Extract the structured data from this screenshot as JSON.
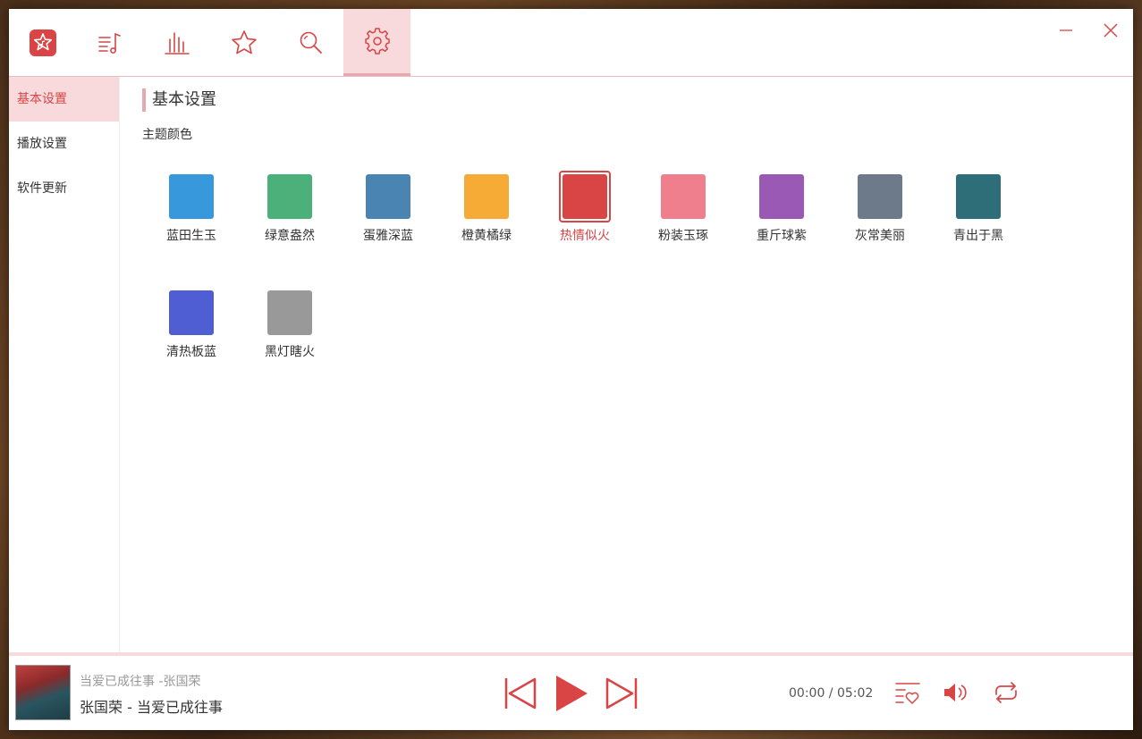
{
  "colors": {
    "accent": "#d94545",
    "accent_light": "#f8d9dc"
  },
  "topnav": {
    "items": [
      {
        "icon": "music-star-logo-icon"
      },
      {
        "icon": "playlist-icon"
      },
      {
        "icon": "chart-bars-icon"
      },
      {
        "icon": "star-icon"
      },
      {
        "icon": "search-icon"
      },
      {
        "icon": "gear-icon",
        "active": true
      }
    ]
  },
  "sidebar": {
    "items": [
      {
        "label": "基本设置",
        "active": true
      },
      {
        "label": "播放设置"
      },
      {
        "label": "软件更新"
      }
    ]
  },
  "main": {
    "title": "基本设置",
    "theme_label": "主题颜色",
    "themes": [
      {
        "name": "蓝田生玉",
        "color": "#3798dc"
      },
      {
        "name": "绿意盎然",
        "color": "#4cb07a"
      },
      {
        "name": "蛋雅深蓝",
        "color": "#4a84b3"
      },
      {
        "name": "橙黄橘绿",
        "color": "#f5ab35"
      },
      {
        "name": "热情似火",
        "color": "#d94545",
        "selected": true
      },
      {
        "name": "粉装玉琢",
        "color": "#f07f8e"
      },
      {
        "name": "重斤球紫",
        "color": "#9b59b6"
      },
      {
        "name": "灰常美丽",
        "color": "#6c7a89"
      },
      {
        "name": "青出于黑",
        "color": "#2e6e78"
      },
      {
        "name": "清热板蓝",
        "color": "#4f5fd3"
      },
      {
        "name": "黑灯瞎火",
        "color": "#999999"
      }
    ]
  },
  "player": {
    "song_subtitle": "当爱已成往事 -张国荣",
    "song_title": "张国荣 - 当爱已成往事",
    "current_time": "00:00",
    "separator": " / ",
    "total_time": "05:02",
    "progress": 0
  }
}
